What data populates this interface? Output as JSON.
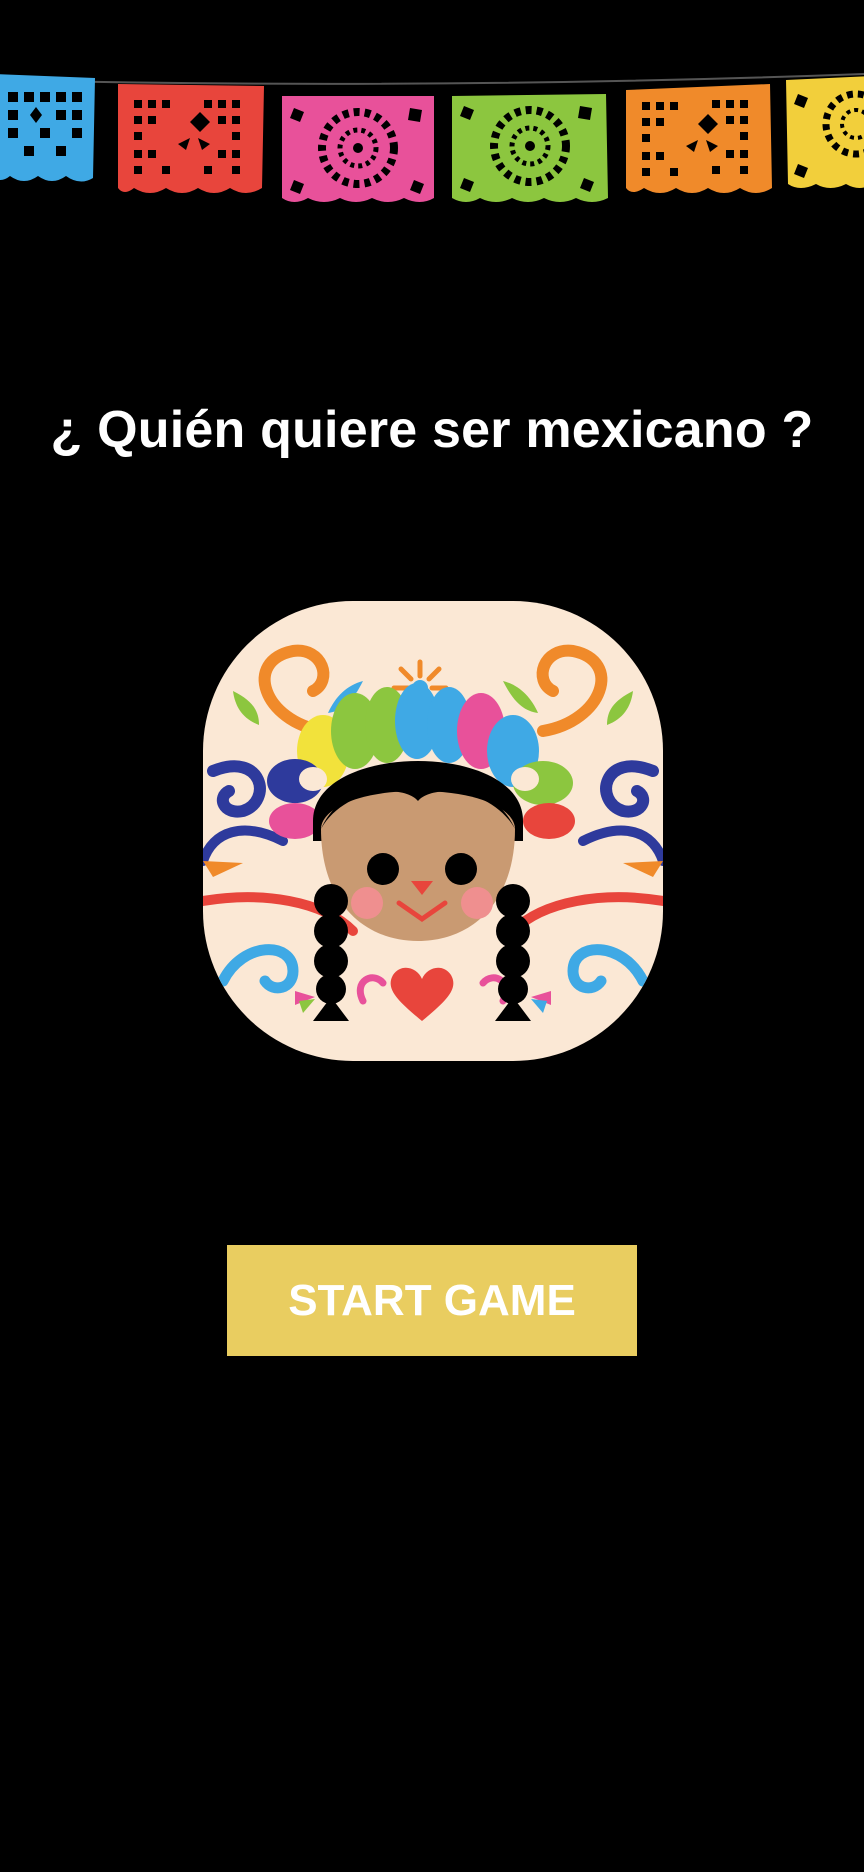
{
  "title": "¿ Quién quiere ser mexicano ?",
  "start_button": {
    "label": "START GAME"
  },
  "banner": {
    "icon": "papel-picado-banner",
    "flag_colors": [
      "#3fa9e5",
      "#e8453c",
      "#e8519a",
      "#8cc63f",
      "#f08a2a",
      "#f2cf3b"
    ]
  },
  "logo": {
    "icon": "mexican-doll-illustration"
  },
  "colors": {
    "background": "#000000",
    "button": "#e9cd60",
    "text": "#ffffff"
  }
}
